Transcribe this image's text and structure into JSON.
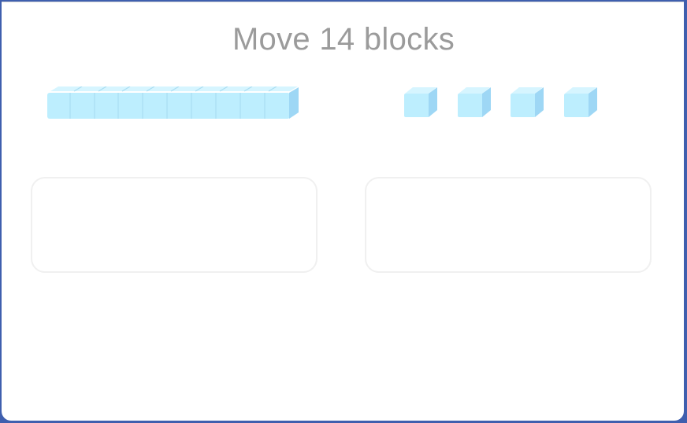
{
  "activity": {
    "title": "Move 14 blocks",
    "tens_rods": 1,
    "ones_cubes": 4
  },
  "colors": {
    "block_face": "#bdeefe",
    "block_top": "#d6f5ff",
    "block_side": "#9ed7f5",
    "block_edge": "#a9ddf2",
    "title_text": "#9b9b9b",
    "zone_border": "#f0f0f0",
    "frame": "#3f5fae"
  },
  "icons": {
    "tens_block": "ten-rod-icon",
    "ones_block": "unit-cube-icon"
  }
}
